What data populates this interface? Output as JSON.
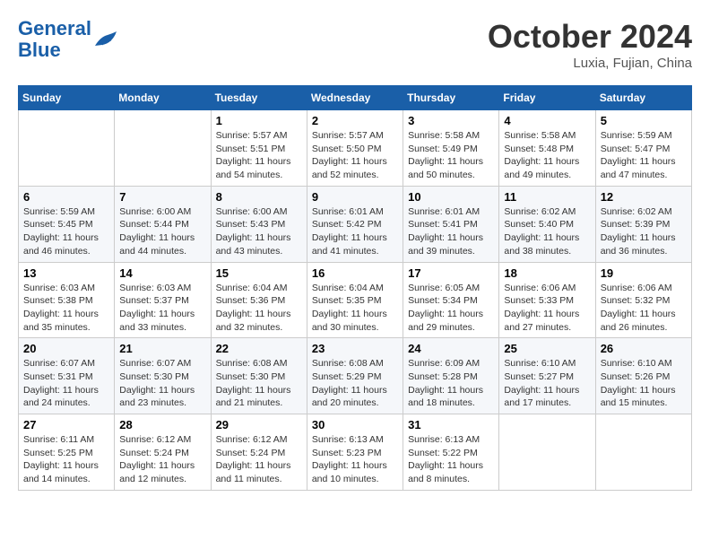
{
  "header": {
    "logo_general": "General",
    "logo_blue": "Blue",
    "title": "October 2024",
    "location": "Luxia, Fujian, China"
  },
  "columns": [
    "Sunday",
    "Monday",
    "Tuesday",
    "Wednesday",
    "Thursday",
    "Friday",
    "Saturday"
  ],
  "weeks": [
    [
      {
        "day": "",
        "info": ""
      },
      {
        "day": "",
        "info": ""
      },
      {
        "day": "1",
        "info": "Sunrise: 5:57 AM\nSunset: 5:51 PM\nDaylight: 11 hours and 54 minutes."
      },
      {
        "day": "2",
        "info": "Sunrise: 5:57 AM\nSunset: 5:50 PM\nDaylight: 11 hours and 52 minutes."
      },
      {
        "day": "3",
        "info": "Sunrise: 5:58 AM\nSunset: 5:49 PM\nDaylight: 11 hours and 50 minutes."
      },
      {
        "day": "4",
        "info": "Sunrise: 5:58 AM\nSunset: 5:48 PM\nDaylight: 11 hours and 49 minutes."
      },
      {
        "day": "5",
        "info": "Sunrise: 5:59 AM\nSunset: 5:47 PM\nDaylight: 11 hours and 47 minutes."
      }
    ],
    [
      {
        "day": "6",
        "info": "Sunrise: 5:59 AM\nSunset: 5:45 PM\nDaylight: 11 hours and 46 minutes."
      },
      {
        "day": "7",
        "info": "Sunrise: 6:00 AM\nSunset: 5:44 PM\nDaylight: 11 hours and 44 minutes."
      },
      {
        "day": "8",
        "info": "Sunrise: 6:00 AM\nSunset: 5:43 PM\nDaylight: 11 hours and 43 minutes."
      },
      {
        "day": "9",
        "info": "Sunrise: 6:01 AM\nSunset: 5:42 PM\nDaylight: 11 hours and 41 minutes."
      },
      {
        "day": "10",
        "info": "Sunrise: 6:01 AM\nSunset: 5:41 PM\nDaylight: 11 hours and 39 minutes."
      },
      {
        "day": "11",
        "info": "Sunrise: 6:02 AM\nSunset: 5:40 PM\nDaylight: 11 hours and 38 minutes."
      },
      {
        "day": "12",
        "info": "Sunrise: 6:02 AM\nSunset: 5:39 PM\nDaylight: 11 hours and 36 minutes."
      }
    ],
    [
      {
        "day": "13",
        "info": "Sunrise: 6:03 AM\nSunset: 5:38 PM\nDaylight: 11 hours and 35 minutes."
      },
      {
        "day": "14",
        "info": "Sunrise: 6:03 AM\nSunset: 5:37 PM\nDaylight: 11 hours and 33 minutes."
      },
      {
        "day": "15",
        "info": "Sunrise: 6:04 AM\nSunset: 5:36 PM\nDaylight: 11 hours and 32 minutes."
      },
      {
        "day": "16",
        "info": "Sunrise: 6:04 AM\nSunset: 5:35 PM\nDaylight: 11 hours and 30 minutes."
      },
      {
        "day": "17",
        "info": "Sunrise: 6:05 AM\nSunset: 5:34 PM\nDaylight: 11 hours and 29 minutes."
      },
      {
        "day": "18",
        "info": "Sunrise: 6:06 AM\nSunset: 5:33 PM\nDaylight: 11 hours and 27 minutes."
      },
      {
        "day": "19",
        "info": "Sunrise: 6:06 AM\nSunset: 5:32 PM\nDaylight: 11 hours and 26 minutes."
      }
    ],
    [
      {
        "day": "20",
        "info": "Sunrise: 6:07 AM\nSunset: 5:31 PM\nDaylight: 11 hours and 24 minutes."
      },
      {
        "day": "21",
        "info": "Sunrise: 6:07 AM\nSunset: 5:30 PM\nDaylight: 11 hours and 23 minutes."
      },
      {
        "day": "22",
        "info": "Sunrise: 6:08 AM\nSunset: 5:30 PM\nDaylight: 11 hours and 21 minutes."
      },
      {
        "day": "23",
        "info": "Sunrise: 6:08 AM\nSunset: 5:29 PM\nDaylight: 11 hours and 20 minutes."
      },
      {
        "day": "24",
        "info": "Sunrise: 6:09 AM\nSunset: 5:28 PM\nDaylight: 11 hours and 18 minutes."
      },
      {
        "day": "25",
        "info": "Sunrise: 6:10 AM\nSunset: 5:27 PM\nDaylight: 11 hours and 17 minutes."
      },
      {
        "day": "26",
        "info": "Sunrise: 6:10 AM\nSunset: 5:26 PM\nDaylight: 11 hours and 15 minutes."
      }
    ],
    [
      {
        "day": "27",
        "info": "Sunrise: 6:11 AM\nSunset: 5:25 PM\nDaylight: 11 hours and 14 minutes."
      },
      {
        "day": "28",
        "info": "Sunrise: 6:12 AM\nSunset: 5:24 PM\nDaylight: 11 hours and 12 minutes."
      },
      {
        "day": "29",
        "info": "Sunrise: 6:12 AM\nSunset: 5:24 PM\nDaylight: 11 hours and 11 minutes."
      },
      {
        "day": "30",
        "info": "Sunrise: 6:13 AM\nSunset: 5:23 PM\nDaylight: 11 hours and 10 minutes."
      },
      {
        "day": "31",
        "info": "Sunrise: 6:13 AM\nSunset: 5:22 PM\nDaylight: 11 hours and 8 minutes."
      },
      {
        "day": "",
        "info": ""
      },
      {
        "day": "",
        "info": ""
      }
    ]
  ]
}
